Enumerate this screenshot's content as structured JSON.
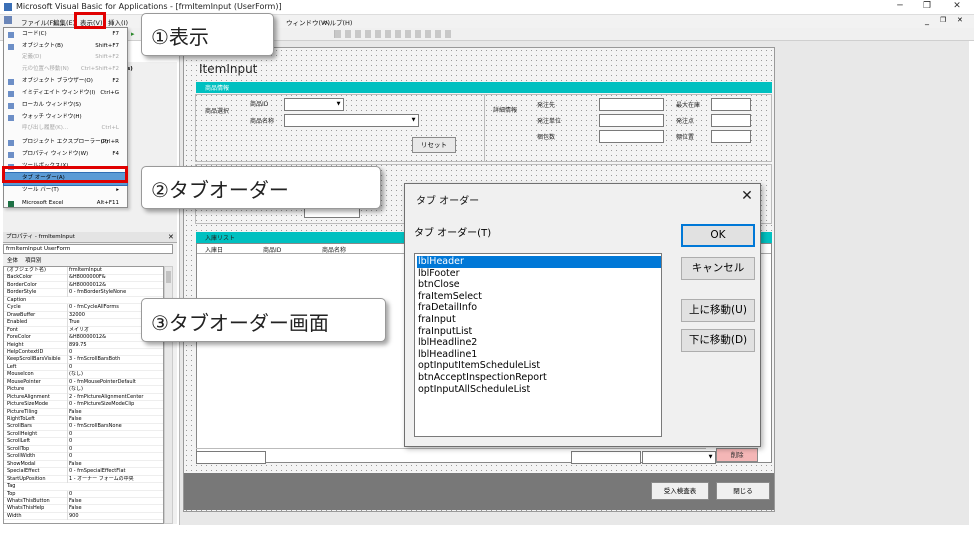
{
  "window": {
    "title": "Microsoft Visual Basic for Applications - [frmItemInput (UserForm)]",
    "minimize": "─",
    "maximize": "❐",
    "close": "✕",
    "inner_min": "_",
    "inner_max": "❐",
    "inner_close": "✕"
  },
  "menubar": {
    "items": [
      {
        "label": "ファイル(F)"
      },
      {
        "label": "編集(E)"
      },
      {
        "label": "表示(V)"
      },
      {
        "label": "挿入(I)"
      },
      {
        "label": "ウィンドウ(W)"
      },
      {
        "label": "ヘルプ(H)"
      }
    ]
  },
  "view_menu": {
    "items": [
      {
        "label": "コード(C)",
        "shortcut": "F7",
        "icon": "code-icon",
        "disabled": false
      },
      {
        "label": "オブジェクト(B)",
        "shortcut": "Shift+F7",
        "icon": "object-icon",
        "disabled": false
      },
      {
        "label": "定義(D)",
        "shortcut": "Shift+F2",
        "icon": "",
        "disabled": true
      },
      {
        "label": "元の位置へ移動(N)",
        "shortcut": "Ctrl+Shift+F2",
        "icon": "",
        "disabled": true
      },
      {
        "label": "オブジェクト ブラウザー(O)",
        "shortcut": "F2",
        "icon": "object-browser-icon",
        "disabled": false
      },
      {
        "label": "イミディエイト ウィンドウ(I)",
        "shortcut": "Ctrl+G",
        "icon": "immediate-window-icon",
        "disabled": false
      },
      {
        "label": "ローカル ウィンドウ(S)",
        "shortcut": "",
        "icon": "locals-window-icon",
        "disabled": false
      },
      {
        "label": "ウォッチ ウィンドウ(H)",
        "shortcut": "",
        "icon": "watch-window-icon",
        "disabled": false
      },
      {
        "label": "呼び出し履歴(K)...",
        "shortcut": "Ctrl+L",
        "icon": "",
        "disabled": true
      },
      {
        "label": "プロジェクト エクスプローラー(P)",
        "shortcut": "Ctrl+R",
        "icon": "project-explorer-icon",
        "disabled": false
      },
      {
        "label": "プロパティ ウィンドウ(W)",
        "shortcut": "F4",
        "icon": "properties-window-icon",
        "disabled": false
      },
      {
        "label": "ツールボックス(X)",
        "shortcut": "",
        "icon": "toolbox-icon",
        "disabled": false
      },
      {
        "label": "タブ オーダー(A)",
        "shortcut": "",
        "icon": "",
        "disabled": false,
        "highlighted": true
      },
      {
        "label": "ツール バー(T)",
        "shortcut": "▸",
        "icon": "",
        "disabled": false
      },
      {
        "label": "Microsoft Excel",
        "shortcut": "Alt+F11",
        "icon": "excel-icon",
        "disabled": false
      }
    ]
  },
  "callouts": {
    "step1": "①表示",
    "step2": "②タブオーダー",
    "step3": "③タブオーダー画面"
  },
  "properties": {
    "title": "プロパティ - frmItemInput",
    "object": "frmItemInput  UserForm",
    "tab_all": "全体",
    "tab_category": "項目別",
    "rows": [
      {
        "k": "(オブジェクト名)",
        "v": "frmItemInput"
      },
      {
        "k": "BackColor",
        "v": "&H8000000F&"
      },
      {
        "k": "BorderColor",
        "v": "&H80000012&"
      },
      {
        "k": "BorderStyle",
        "v": "0 - fmBorderStyleNone"
      },
      {
        "k": "Caption",
        "v": ""
      },
      {
        "k": "Cycle",
        "v": "0 - fmCycleAllForms"
      },
      {
        "k": "DrawBuffer",
        "v": "32000"
      },
      {
        "k": "Enabled",
        "v": "True"
      },
      {
        "k": "Font",
        "v": "メイリオ"
      },
      {
        "k": "ForeColor",
        "v": "&H80000012&"
      },
      {
        "k": "Height",
        "v": "899.75"
      },
      {
        "k": "HelpContextID",
        "v": "0"
      },
      {
        "k": "KeepScrollBarsVisible",
        "v": "3 - fmScrollBarsBoth"
      },
      {
        "k": "Left",
        "v": "0"
      },
      {
        "k": "MouseIcon",
        "v": "(なし)"
      },
      {
        "k": "MousePointer",
        "v": "0 - fmMousePointerDefault"
      },
      {
        "k": "Picture",
        "v": "(なし)"
      },
      {
        "k": "PictureAlignment",
        "v": "2 - fmPictureAlignmentCenter"
      },
      {
        "k": "PictureSizeMode",
        "v": "0 - fmPictureSizeModeClip"
      },
      {
        "k": "PictureTiling",
        "v": "False"
      },
      {
        "k": "RightToLeft",
        "v": "False"
      },
      {
        "k": "ScrollBars",
        "v": "0 - fmScrollBarsNone"
      },
      {
        "k": "ScrollHeight",
        "v": "0"
      },
      {
        "k": "ScrollLeft",
        "v": "0"
      },
      {
        "k": "ScrollTop",
        "v": "0"
      },
      {
        "k": "ScrollWidth",
        "v": "0"
      },
      {
        "k": "ShowModal",
        "v": "False"
      },
      {
        "k": "SpecialEffect",
        "v": "0 - fmSpecialEffectFlat"
      },
      {
        "k": "StartUpPosition",
        "v": "1 - オーナー フォームの中央"
      },
      {
        "k": "Tag",
        "v": ""
      },
      {
        "k": "Top",
        "v": "0"
      },
      {
        "k": "WhatsThisButton",
        "v": "False"
      },
      {
        "k": "WhatsThisHelp",
        "v": "False"
      },
      {
        "k": "Width",
        "v": "900"
      }
    ]
  },
  "form": {
    "title": "ItemInput",
    "item_info_header": "商品情報",
    "item_select_label": "商品選択",
    "item_id_label": "商品ID",
    "item_name_label": "商品名称",
    "reset_button": "リセット",
    "detail_label": "詳細情報",
    "details_left": [
      "発注先",
      "発注単位",
      "梱包数"
    ],
    "details_right": [
      "最大在庫",
      "発注点",
      "棚位置"
    ],
    "list_header": "入庫リスト",
    "list_columns": [
      "入庫日",
      "商品ID",
      "商品名称"
    ],
    "delete_button": "削除",
    "accept_button": "受入検査表",
    "close_button": "閉じる"
  },
  "dialog": {
    "title": "タブ オーダー",
    "close": "✕",
    "list_label": "タブ オーダー(T)",
    "items": [
      "lblHeader",
      "lblFooter",
      "btnClose",
      "fraItemSelect",
      "fraDetailInfo",
      "fraInput",
      "fraInputList",
      "lblHeadline2",
      "lblHeadline1",
      "optInputItemScheduleList",
      "btnAcceptInspectionReport",
      "optInputAllScheduleList"
    ],
    "selected_index": 0,
    "ok": "OK",
    "cancel": "キャンセル",
    "move_up": "上に移動(U)",
    "move_down": "下に移動(D)"
  },
  "colors": {
    "accent_teal": "#00c0c0",
    "highlight_red": "#e00000",
    "selection_blue": "#0078d7"
  }
}
